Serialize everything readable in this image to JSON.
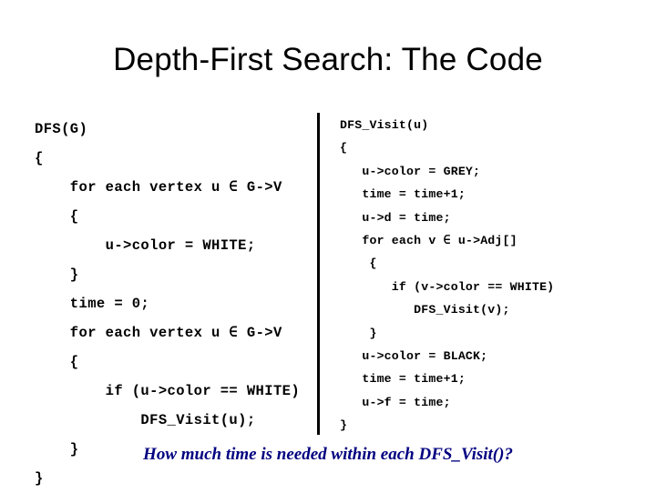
{
  "slide": {
    "title": "Depth-First Search: The Code",
    "background_color": "#ffffff",
    "text_color": "#000000"
  },
  "divider": {
    "orientation": "vertical",
    "color": "#000000"
  },
  "code_left": {
    "name": "DFS",
    "lines": [
      "DFS(G)",
      "{",
      "    for each vertex u ∈ G->V",
      "    {",
      "        u->color = WHITE;",
      "    }",
      "    time = 0;",
      "    for each vertex u ∈ G->V",
      "    {",
      "        if (u->color == WHITE)",
      "            DFS_Visit(u);",
      "    }",
      "}"
    ]
  },
  "code_right": {
    "name": "DFS_Visit",
    "lines": [
      "DFS_Visit(u)",
      "{",
      "   u->color = GREY;",
      "   time = time+1;",
      "   u->d = time;",
      "   for each v ∈ u->Adj[]",
      "    {",
      "       if (v->color == WHITE)",
      "          DFS_Visit(v);",
      "    }",
      "   u->color = BLACK;",
      "   time = time+1;",
      "   u->f = time;",
      "}"
    ]
  },
  "caption": {
    "text": "How much time is needed within each DFS_Visit()?",
    "color": "#000080"
  }
}
